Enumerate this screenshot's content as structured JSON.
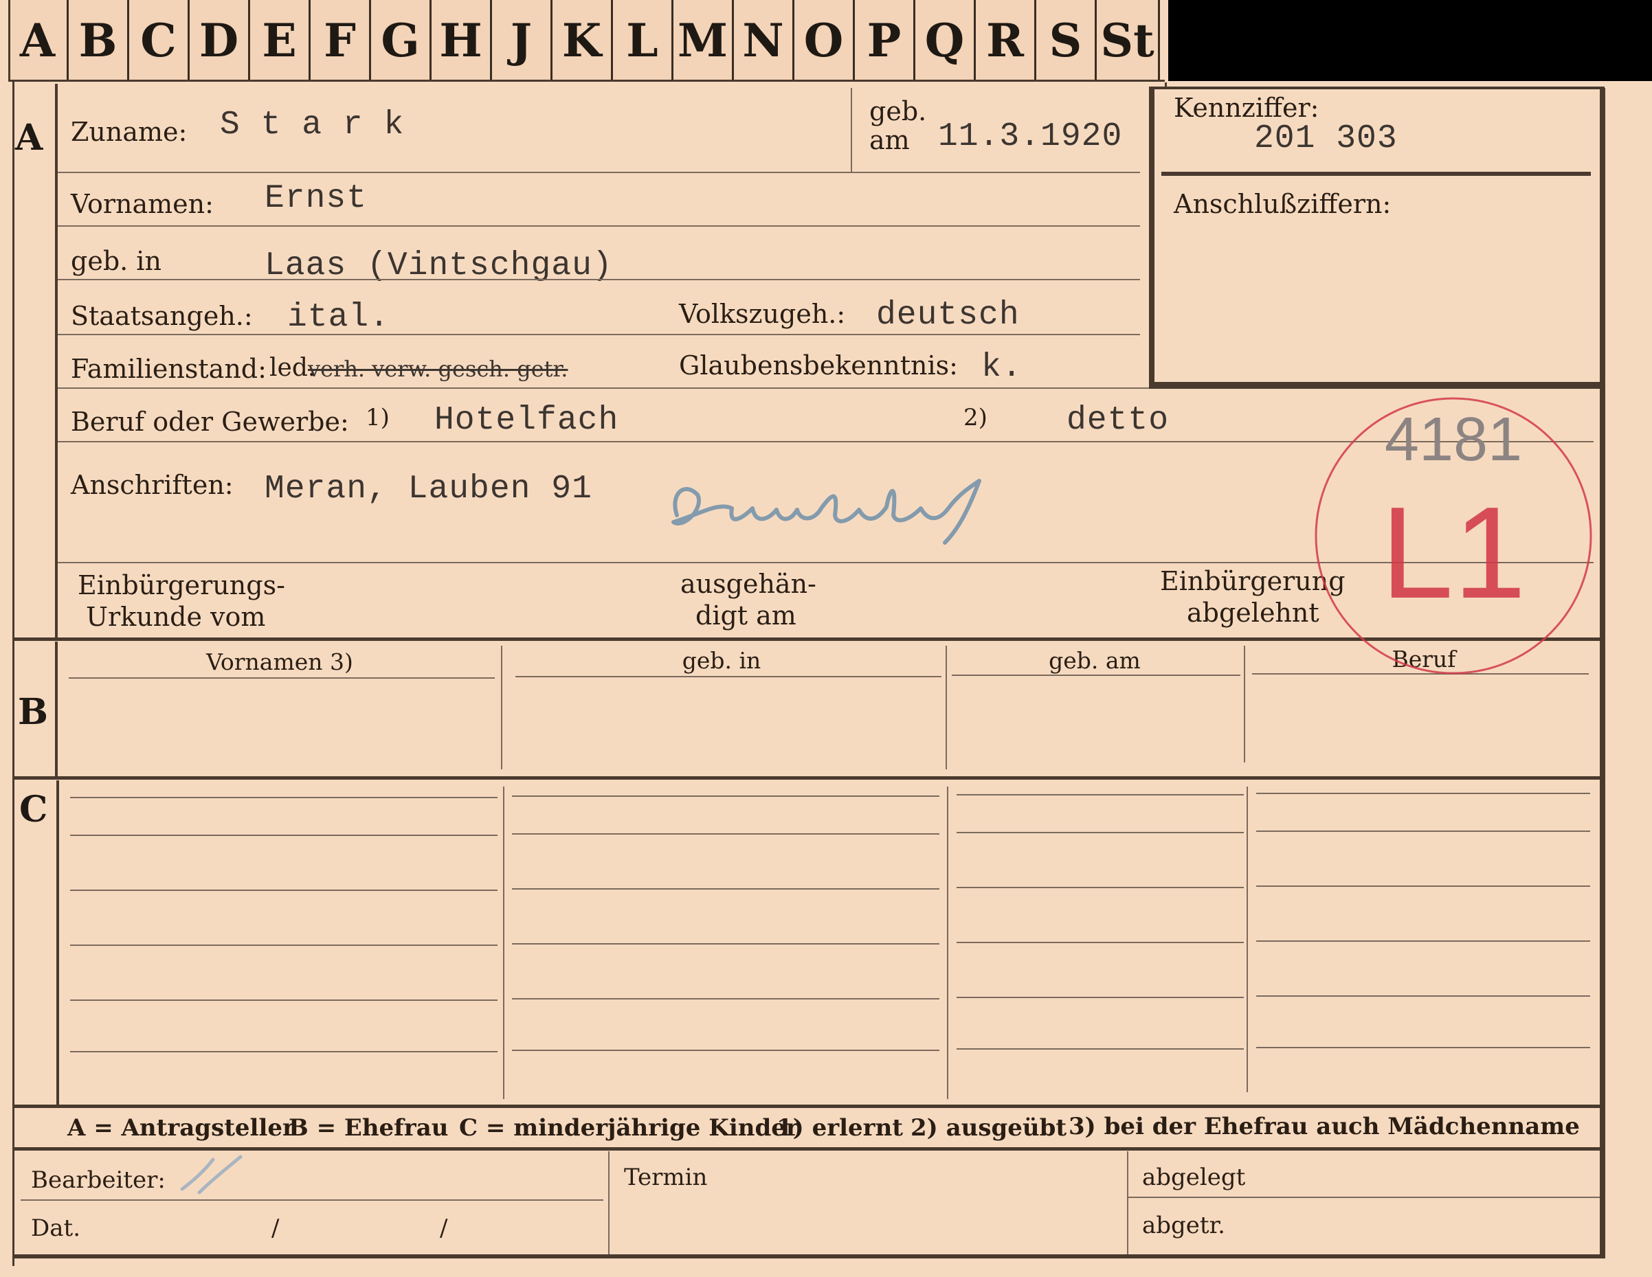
{
  "tabs": [
    "A",
    "B",
    "C",
    "D",
    "E",
    "F",
    "G",
    "H",
    "J",
    "K",
    "L",
    "M",
    "N",
    "O",
    "P",
    "Q",
    "R",
    "S",
    "St"
  ],
  "sectionA": {
    "letter": "A",
    "zuname_label": "Zuname:",
    "zuname_value": "S t a r k",
    "geb_label_1": "geb.",
    "geb_label_2": "am",
    "geb_am_value": "11.3.1920",
    "kennziffer_label": "Kennziffer:",
    "kennziffer_value": "201 303",
    "anschlussziffern_label": "Anschlußziffern:",
    "vornamen_label": "Vornamen:",
    "vornamen_value": "Ernst",
    "geb_in_label": "geb. in",
    "geb_in_value": "Laas (Vintschgau)",
    "staatsangeh_label": "Staatsangeh.:",
    "staatsangeh_value": "ital.",
    "volkszugeh_label": "Volkszugeh.:",
    "volkszugeh_value": "deutsch",
    "familienstand_label": "Familienstand:",
    "familienstand_value": "led.",
    "familienstand_struck": "verh. verw. gesch. getr.",
    "glaubens_label": "Glaubensbekenntnis:",
    "glaubens_value": "k.",
    "beruf_label": "Beruf oder Gewerbe:",
    "beruf_marker_1": "1)",
    "beruf_value_1": "Hotelfach",
    "beruf_marker_2": "2)",
    "beruf_value_2": "detto",
    "anschriften_label": "Anschriften:",
    "anschriften_value": "Meran, Lauben 91",
    "signature": "Landeck",
    "einb_urkunde_label_1": "Einbürgerungs-",
    "einb_urkunde_label_2": "Urkunde vom",
    "ausgehaendigt_label_1": "ausgehän-",
    "ausgehaendigt_label_2": "digt am",
    "einb_abgelehnt_label_1": "Einbürgerung",
    "einb_abgelehnt_label_2": "abgelehnt"
  },
  "stamp": {
    "number": "4181",
    "code": "L1",
    "color": "#d23a48"
  },
  "sectionB": {
    "letter": "B",
    "columns": [
      "Vornamen 3)",
      "geb. in",
      "geb. am",
      "Beruf"
    ]
  },
  "sectionC": {
    "letter": "C"
  },
  "legend": {
    "a": "A = Antragsteller",
    "b": "B = Ehefrau",
    "c": "C = minderjährige Kinder",
    "n1": "1) erlernt",
    "n2": "2) ausgeübt",
    "n3": "3) bei der Ehefrau auch Mädchenname"
  },
  "footer": {
    "bearbeiter_label": "Bearbeiter:",
    "dat_label": "Dat.",
    "dat_sep_1": "/",
    "dat_sep_2": "/",
    "termin_label": "Termin",
    "abgelegt_label": "abgelegt",
    "abgetr_label": "abgetr."
  },
  "colors": {
    "paper": "#f6dac0",
    "ink": "#2a1e14",
    "typewriter": "#3c3530",
    "signature": "#6f8fa8"
  }
}
